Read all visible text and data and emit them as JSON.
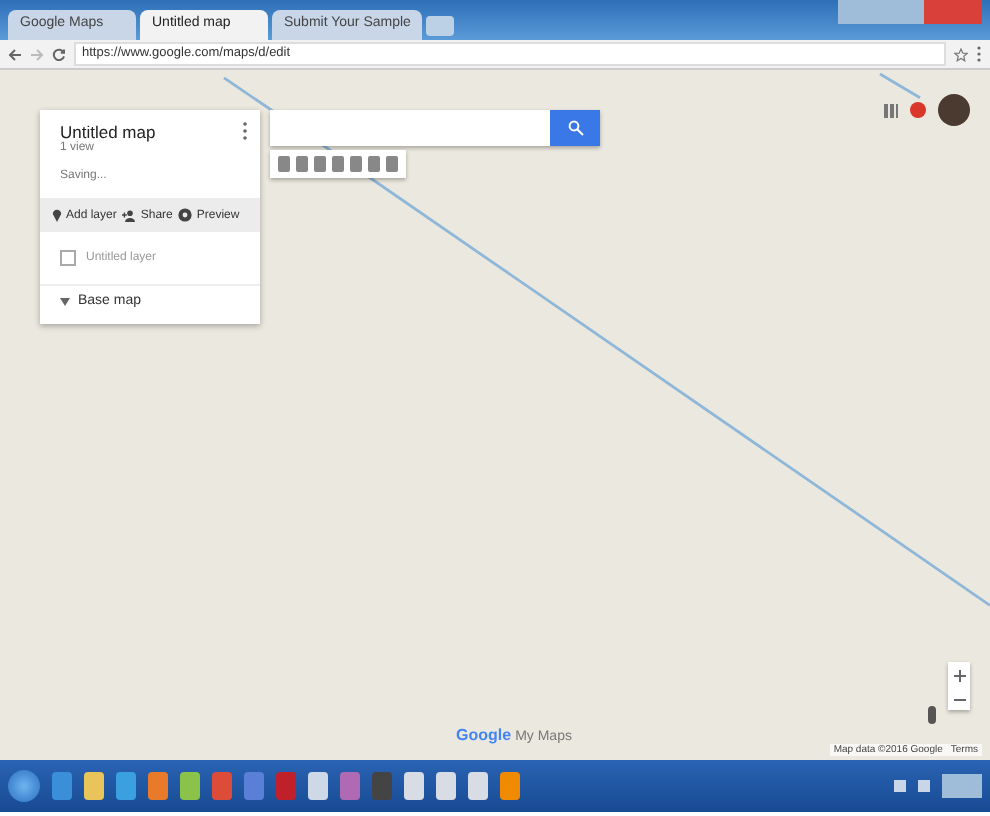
{
  "browser": {
    "tabs": [
      {
        "label": "Google Maps",
        "selected": false
      },
      {
        "label": "Untitled map",
        "selected": true
      },
      {
        "label": "Submit Your Sample",
        "selected": false
      }
    ],
    "url": "https://www.google.com/maps/d/edit"
  },
  "panel": {
    "title": "Untitled map",
    "subtitle": "1 view",
    "status": "Saving...",
    "actions": [
      {
        "kind": "layer",
        "label": "Add layer"
      },
      {
        "kind": "share",
        "label": "Share"
      },
      {
        "kind": "preview",
        "label": "Preview"
      }
    ],
    "layer": {
      "name": "Untitled layer",
      "checked": false
    },
    "base_map": "Base map"
  },
  "logo": {
    "brand": "Google",
    "product": "My Maps"
  },
  "footer": {
    "attribution": "Map data ©2016 Google",
    "terms": "Terms"
  }
}
